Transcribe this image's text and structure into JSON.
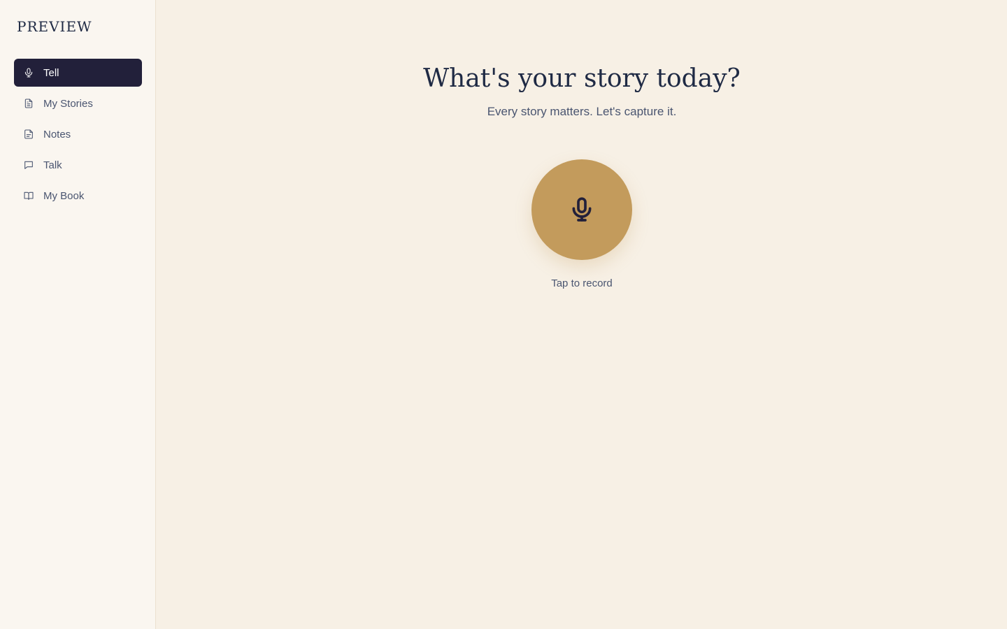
{
  "app": {
    "logo": "PREVIEW"
  },
  "sidebar": {
    "items": [
      {
        "label": "Tell",
        "icon": "mic-icon",
        "active": true
      },
      {
        "label": "My Stories",
        "icon": "document-icon",
        "active": false
      },
      {
        "label": "Notes",
        "icon": "note-icon",
        "active": false
      },
      {
        "label": "Talk",
        "icon": "chat-icon",
        "active": false
      },
      {
        "label": "My Book",
        "icon": "book-icon",
        "active": false
      }
    ]
  },
  "main": {
    "title": "What's your story today?",
    "subtitle": "Every story matters. Let's capture it.",
    "record": {
      "icon": "mic-icon",
      "hint": "Tap to record"
    }
  },
  "colors": {
    "background": "#f7f0e5",
    "sidebar_background": "#faf6f0",
    "active_nav": "#22203a",
    "accent": "#c39b5c",
    "text_primary": "#1f2a44",
    "text_secondary": "#4a5570"
  }
}
